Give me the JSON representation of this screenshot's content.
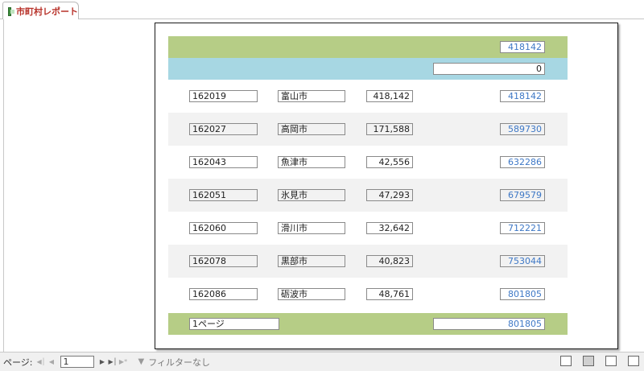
{
  "tab": {
    "title": "市町村レポート",
    "icon": "report-icon"
  },
  "report": {
    "header_total": "418142",
    "group_value": "0",
    "rows": [
      {
        "code": "162019",
        "name": "富山市",
        "population": "418,142",
        "cumulative": "418142"
      },
      {
        "code": "162027",
        "name": "高岡市",
        "population": "171,588",
        "cumulative": "589730"
      },
      {
        "code": "162043",
        "name": "魚津市",
        "population": "42,556",
        "cumulative": "632286"
      },
      {
        "code": "162051",
        "name": "氷見市",
        "population": "47,293",
        "cumulative": "679579"
      },
      {
        "code": "162060",
        "name": "滑川市",
        "population": "32,642",
        "cumulative": "712221"
      },
      {
        "code": "162078",
        "name": "黒部市",
        "population": "40,823",
        "cumulative": "753044"
      },
      {
        "code": "162086",
        "name": "砺波市",
        "population": "48,761",
        "cumulative": "801805"
      }
    ],
    "footer_page": "1ページ",
    "footer_total": "801805"
  },
  "colors": {
    "header_band": "#b6cd86",
    "group_band": "#a7d7e3",
    "alt_row": "#f2f2f2",
    "link": "#3e78c6",
    "tab_text": "#b8322a"
  },
  "navbar": {
    "label": "ページ:",
    "page_value": "1",
    "filter_label": "フィルターなし",
    "icons": [
      "first-page-icon",
      "prev-page-icon",
      "next-page-icon",
      "last-page-icon",
      "new-record-icon",
      "filter-icon"
    ]
  }
}
